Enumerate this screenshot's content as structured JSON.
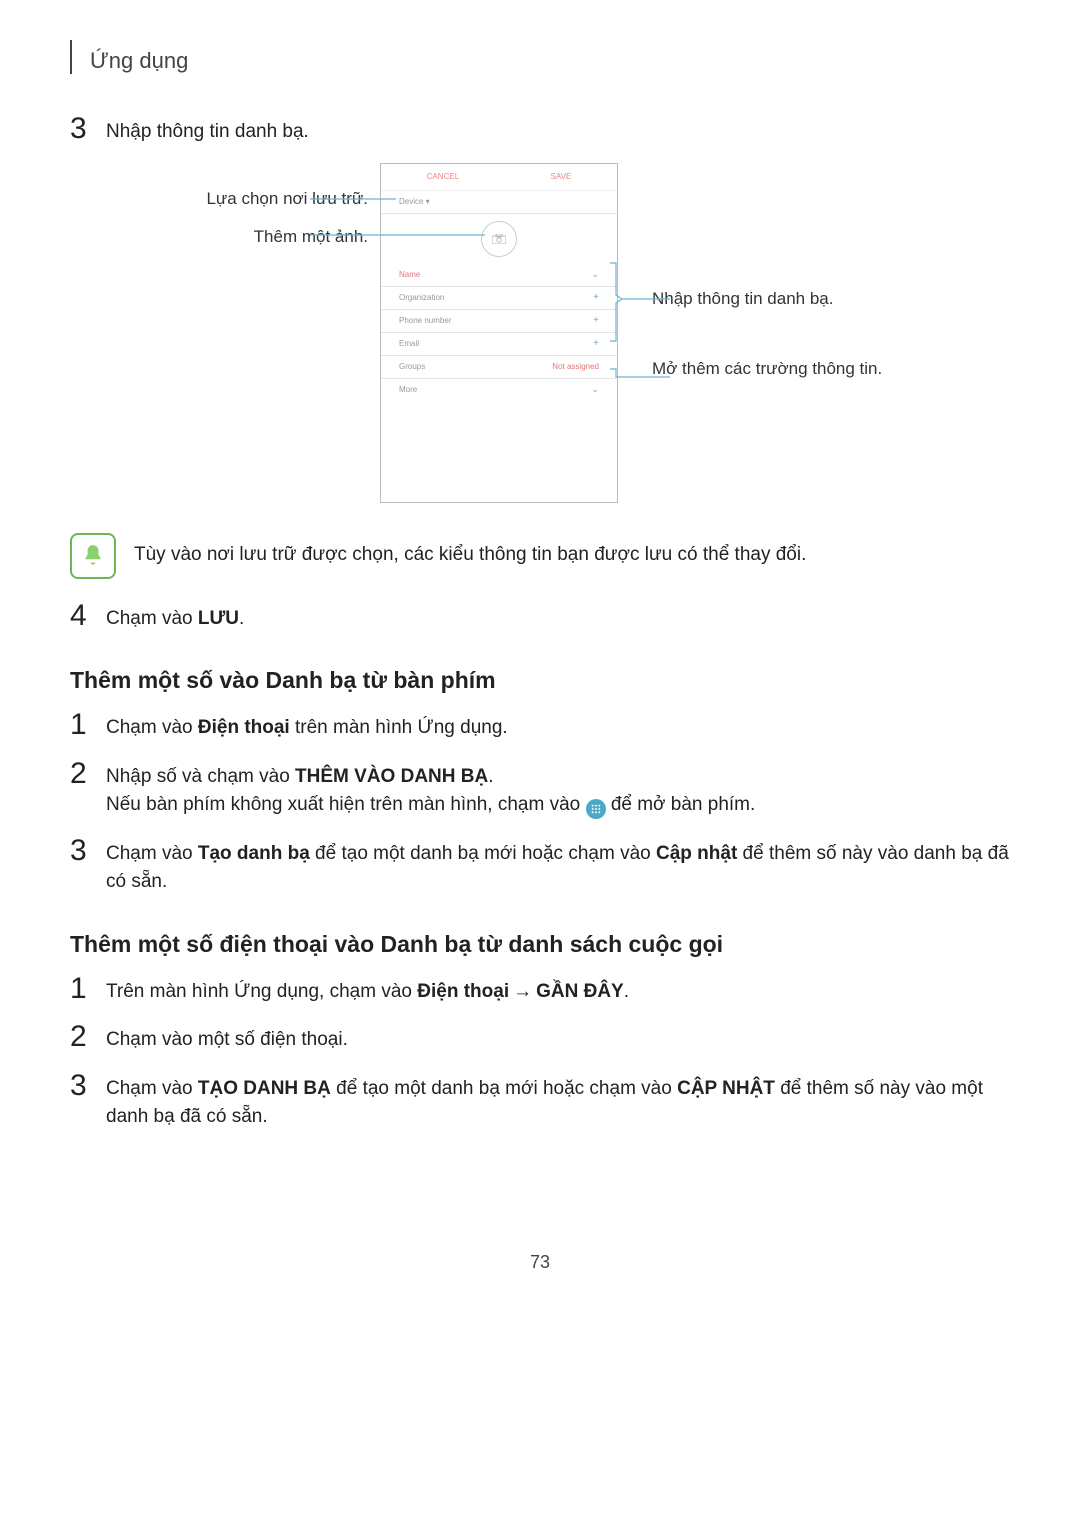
{
  "header": {
    "title": "Ứng dụng"
  },
  "step3": {
    "num": "3",
    "text": "Nhập thông tin danh bạ."
  },
  "illustration": {
    "left_callouts": {
      "storage": "Lựa chọn nơi lưu trữ.",
      "photo": "Thêm một ảnh."
    },
    "right_callouts": {
      "enter_info": "Nhập thông tin danh bạ.",
      "more_fields": "Mở thêm các trường thông tin."
    },
    "phone_ui": {
      "cancel": "CANCEL",
      "save": "SAVE",
      "device_dropdown": "Device ▾",
      "rows": {
        "name": "Name",
        "organization": "Organization",
        "phone": "Phone number",
        "email": "Email",
        "groups_label": "Groups",
        "groups_value": "Not assigned",
        "more": "More"
      }
    }
  },
  "note": {
    "text": "Tùy vào nơi lưu trữ được chọn, các kiểu thông tin bạn được lưu có thể thay đổi."
  },
  "step4": {
    "num": "4",
    "pre": "Chạm vào ",
    "bold": "LƯU",
    "post": "."
  },
  "sectionA": {
    "title": "Thêm một số vào Danh bạ từ bàn phím",
    "s1": {
      "num": "1",
      "pre": "Chạm vào ",
      "b1": "Điện thoại",
      "post": " trên màn hình Ứng dụng."
    },
    "s2": {
      "num": "2",
      "line1_pre": "Nhập số và chạm vào ",
      "line1_b": "THÊM VÀO DANH BẠ",
      "line1_post": ".",
      "line2_pre": "Nếu bàn phím không xuất hiện trên màn hình, chạm vào ",
      "line2_post": " để mở bàn phím."
    },
    "s3": {
      "num": "3",
      "pre": "Chạm vào ",
      "b1": "Tạo danh bạ",
      "mid": " để tạo một danh bạ mới hoặc chạm vào ",
      "b2": "Cập nhật",
      "post": " để thêm số này vào danh bạ đã có sẵn."
    }
  },
  "sectionB": {
    "title": "Thêm một số điện thoại vào Danh bạ từ danh sách cuộc gọi",
    "s1": {
      "num": "1",
      "pre": "Trên màn hình Ứng dụng, chạm vào ",
      "b1": "Điện thoại",
      "arrow": "→",
      "b2": "GẦN ĐÂY",
      "post": "."
    },
    "s2": {
      "num": "2",
      "text": "Chạm vào một số điện thoại."
    },
    "s3": {
      "num": "3",
      "pre": "Chạm vào ",
      "b1": "TẠO DANH BẠ",
      "mid": " để tạo một danh bạ mới hoặc chạm vào ",
      "b2": "CẬP NHẬT",
      "post": " để thêm số này vào một danh bạ đã có sẵn."
    }
  },
  "page_number": "73"
}
